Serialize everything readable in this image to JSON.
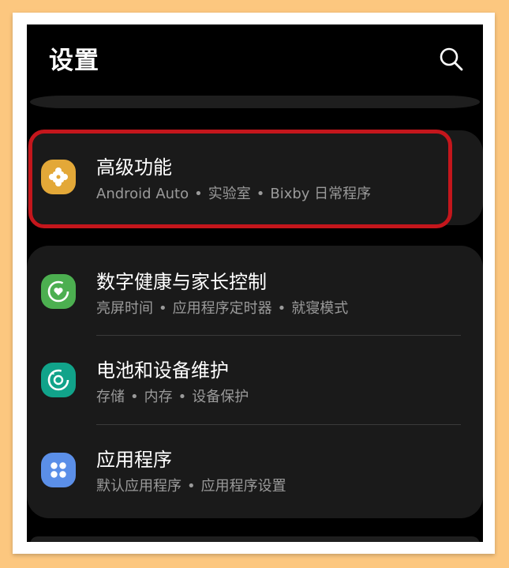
{
  "header": {
    "title": "设置",
    "search_icon": "search-icon"
  },
  "colors": {
    "background": "#fcc77f",
    "screen": "#000000",
    "card": "#1a1a1a",
    "highlight_border": "#c4161c",
    "icon_advanced": "#e3a838",
    "icon_digital_wellbeing": "#4caf50",
    "icon_battery": "#11a38a",
    "icon_apps": "#5b8fe8"
  },
  "items": [
    {
      "title": "高级功能",
      "subtitle_parts": [
        "Android Auto",
        "实验室",
        "Bixby 日常程序"
      ],
      "icon": "puzzle-icon",
      "highlighted": true
    },
    {
      "title": "数字健康与家长控制",
      "subtitle_parts": [
        "亮屏时间",
        "应用程序定时器",
        "就寝模式"
      ],
      "icon": "heart-circle-icon"
    },
    {
      "title": "电池和设备维护",
      "subtitle_parts": [
        "存储",
        "内存",
        "设备保护"
      ],
      "icon": "refresh-circle-icon"
    },
    {
      "title": "应用程序",
      "subtitle_parts": [
        "默认应用程序",
        "应用程序设置"
      ],
      "icon": "four-dots-icon"
    }
  ],
  "separator": "•"
}
